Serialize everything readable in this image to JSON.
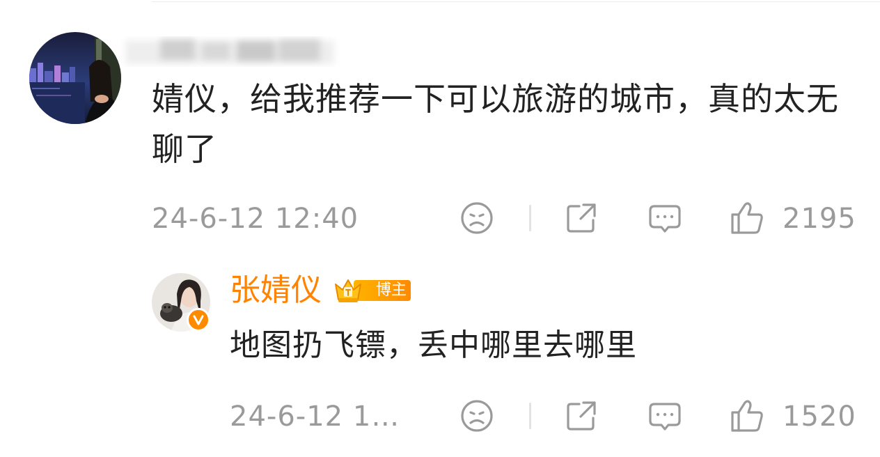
{
  "comment": {
    "text": "婧仪，给我推荐一下可以旅游的城市，真的太无聊了",
    "timestamp": "24-6-12 12:40",
    "like_count": "2195",
    "avatar_icon": "avatar-photo-night-city"
  },
  "reply": {
    "author": "张婧仪",
    "badge_label": "博主",
    "text": "地图扔飞镖，丢中哪里去哪里",
    "timestamp": "24-6-12 1…",
    "like_count": "1520",
    "avatar_icon": "avatar-photo-with-dog",
    "verified_icon": "verified-v-icon"
  },
  "actions": {
    "dislike_icon": "sad-face-icon",
    "share_icon": "share-icon",
    "reply_icon": "comment-bubble-icon",
    "like_icon": "thumbs-up-icon"
  },
  "colors": {
    "text": "#222222",
    "meta": "#9a9a9a",
    "accent": "#ff8200",
    "divider": "#e3e3e3"
  }
}
